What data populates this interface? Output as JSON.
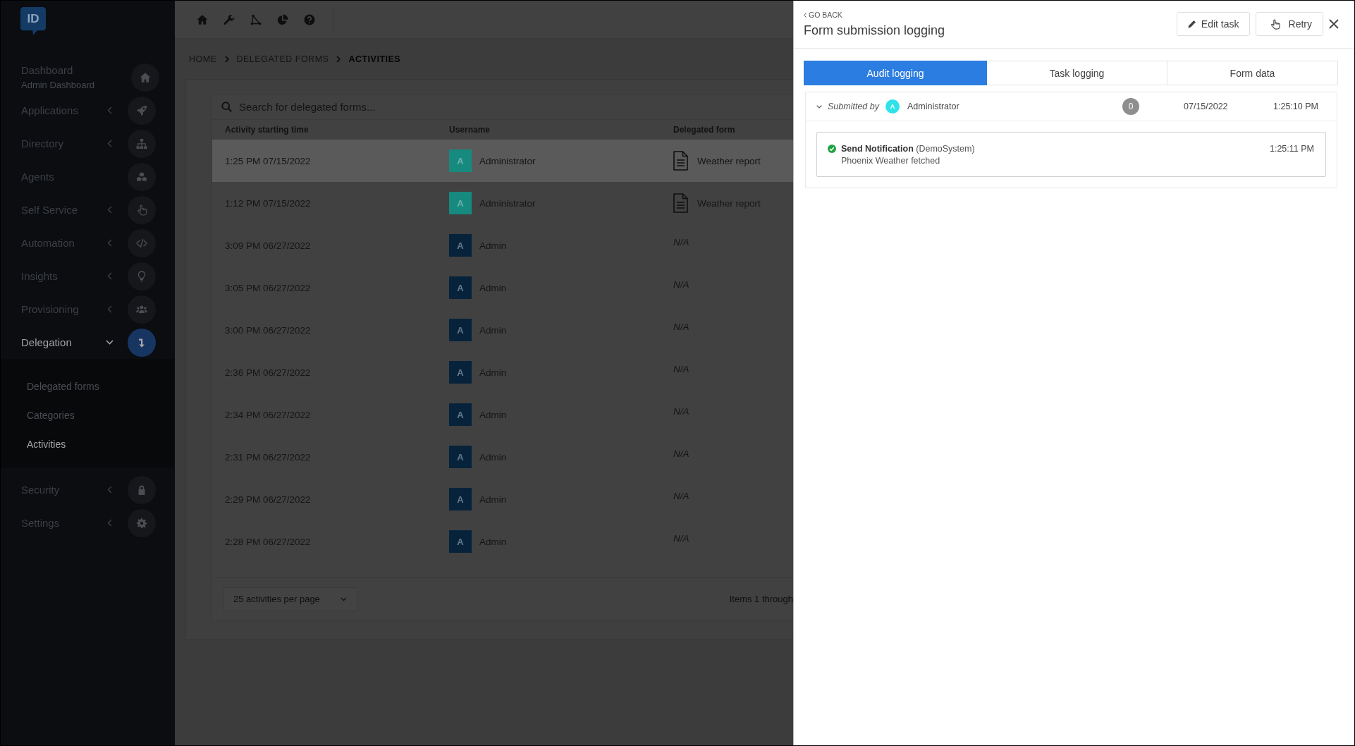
{
  "sidebar": {
    "logo": "ID",
    "items": [
      {
        "label": "Dashboard",
        "subtitle": "Admin Dashboard",
        "selected": false
      },
      {
        "label": "Applications",
        "expanded": false,
        "selected": false
      },
      {
        "label": "Directory",
        "expanded": false,
        "selected": false
      },
      {
        "label": "Agents",
        "selected": false
      },
      {
        "label": "Self Service",
        "expanded": false,
        "selected": false
      },
      {
        "label": "Automation",
        "expanded": false,
        "selected": false
      },
      {
        "label": "Insights",
        "expanded": false,
        "selected": false
      },
      {
        "label": "Provisioning",
        "expanded": false,
        "selected": false
      },
      {
        "label": "Delegation",
        "expanded": true,
        "selected": true,
        "children": [
          {
            "label": "Delegated forms",
            "selected": false
          },
          {
            "label": "Categories",
            "selected": false
          },
          {
            "label": "Activities",
            "selected": true
          }
        ]
      },
      {
        "label": "Security",
        "expanded": false,
        "selected": false
      },
      {
        "label": "Settings",
        "expanded": false,
        "selected": false
      }
    ]
  },
  "breadcrumb": [
    {
      "label": "HOME",
      "current": false
    },
    {
      "label": "DELEGATED FORMS",
      "current": false
    },
    {
      "label": "ACTIVITIES",
      "current": true
    }
  ],
  "activities": {
    "search": {
      "placeholder": "Search for delegated forms..."
    },
    "columns": [
      "Activity starting time",
      "Username",
      "Delegated form"
    ],
    "rows": [
      {
        "time": "1:25 PM 07/15/2022",
        "user": {
          "initial": "A",
          "name": "Administrator",
          "color": "#178a7f"
        },
        "form": {
          "kind": "document",
          "label": "Weather report"
        },
        "selected": true
      },
      {
        "time": "1:12 PM 07/15/2022",
        "user": {
          "initial": "A",
          "name": "Administrator",
          "color": "#178a7f"
        },
        "form": {
          "kind": "document",
          "label": "Weather report"
        },
        "selected": false
      },
      {
        "time": "3:09 PM 06/27/2022",
        "user": {
          "initial": "A",
          "name": "Admin",
          "color": "#07233b"
        },
        "form": {
          "kind": "none",
          "label": "N/A"
        },
        "selected": false
      },
      {
        "time": "3:05 PM 06/27/2022",
        "user": {
          "initial": "A",
          "name": "Admin",
          "color": "#07233b"
        },
        "form": {
          "kind": "none",
          "label": "N/A"
        },
        "selected": false
      },
      {
        "time": "3:00 PM 06/27/2022",
        "user": {
          "initial": "A",
          "name": "Admin",
          "color": "#07233b"
        },
        "form": {
          "kind": "none",
          "label": "N/A"
        },
        "selected": false
      },
      {
        "time": "2:36 PM 06/27/2022",
        "user": {
          "initial": "A",
          "name": "Admin",
          "color": "#07233b"
        },
        "form": {
          "kind": "none",
          "label": "N/A"
        },
        "selected": false
      },
      {
        "time": "2:34 PM 06/27/2022",
        "user": {
          "initial": "A",
          "name": "Admin",
          "color": "#07233b"
        },
        "form": {
          "kind": "none",
          "label": "N/A"
        },
        "selected": false
      },
      {
        "time": "2:31 PM 06/27/2022",
        "user": {
          "initial": "A",
          "name": "Admin",
          "color": "#07233b"
        },
        "form": {
          "kind": "none",
          "label": "N/A"
        },
        "selected": false
      },
      {
        "time": "2:29 PM 06/27/2022",
        "user": {
          "initial": "A",
          "name": "Admin",
          "color": "#07233b"
        },
        "form": {
          "kind": "none",
          "label": "N/A"
        },
        "selected": false
      },
      {
        "time": "2:28 PM 06/27/2022",
        "user": {
          "initial": "A",
          "name": "Admin",
          "color": "#07233b"
        },
        "form": {
          "kind": "none",
          "label": "N/A"
        },
        "selected": false
      }
    ],
    "page_size": "25 activities per page",
    "range": "Items 1 through"
  },
  "panel": {
    "back": "GO BACK",
    "title": "Form submission logging",
    "actions": [
      "Edit task",
      "Retry"
    ],
    "tabs": [
      {
        "label": "Audit logging",
        "selected": true
      },
      {
        "label": "Task logging",
        "selected": false
      },
      {
        "label": "Form data",
        "selected": false
      }
    ],
    "submission": {
      "expanded": true,
      "label": "Submitted by",
      "user": {
        "initial": "A",
        "name": "Administrator"
      },
      "count": "0",
      "date": "07/15/2022",
      "time": "1:25:10 PM",
      "entries": [
        {
          "success": true,
          "title": "Send Notification",
          "source": "(DemoSystem)",
          "message": "Phoenix Weather fetched",
          "time": "1:25:11 PM"
        }
      ]
    }
  }
}
